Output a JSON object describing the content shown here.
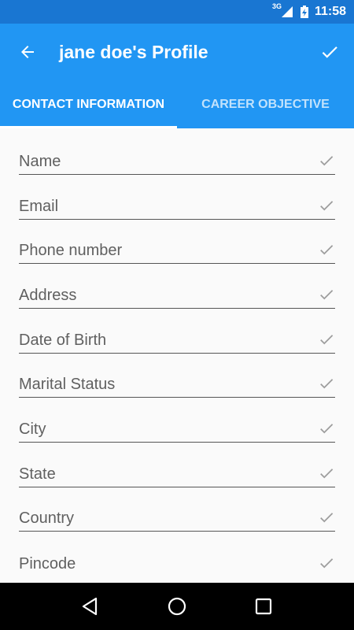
{
  "status_bar": {
    "network": "3G",
    "time": "11:58"
  },
  "app_bar": {
    "title": "jane doe's Profile",
    "back_icon": "arrow-back-icon",
    "save_icon": "check-icon"
  },
  "tabs": [
    {
      "label": "CONTACT INFORMATION",
      "active": true
    },
    {
      "label": "CAREER OBJECTIVE",
      "active": false
    }
  ],
  "fields": [
    {
      "placeholder": "Name"
    },
    {
      "placeholder": "Email"
    },
    {
      "placeholder": "Phone number"
    },
    {
      "placeholder": "Address"
    },
    {
      "placeholder": "Date of Birth"
    },
    {
      "placeholder": "Marital Status"
    },
    {
      "placeholder": "City"
    },
    {
      "placeholder": "State"
    },
    {
      "placeholder": "Country"
    },
    {
      "placeholder": "Pincode"
    }
  ],
  "colors": {
    "primary": "#2196f3",
    "primary_dark": "#1976d2"
  }
}
